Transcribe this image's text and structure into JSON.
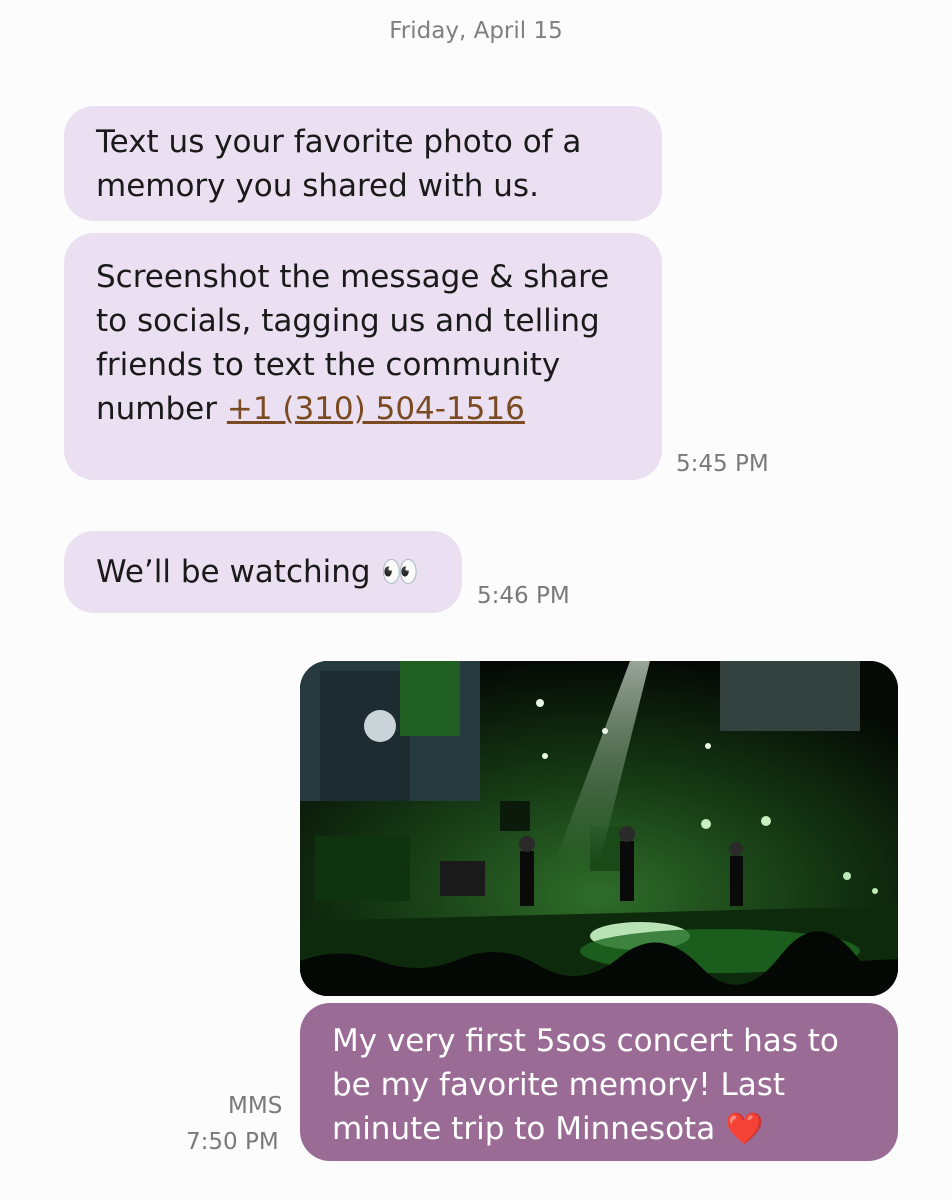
{
  "thread": {
    "date_header": "Friday, April 15"
  },
  "messages": {
    "m1": {
      "text": "Text us your favorite photo of a memory you shared with us."
    },
    "m2": {
      "text": "Screenshot the message & share to socials, tagging us and telling friends to text the community number ",
      "link": "+1 (310) 504-1516",
      "time": "5:45 PM"
    },
    "m3": {
      "text": "We’ll be watching",
      "emoji": "👀",
      "time": "5:46 PM"
    },
    "m4": {
      "text": "My very first 5sos concert has to be my favorite  memory! Last minute trip to Minnesota",
      "emoji": "❤️",
      "type_label": "MMS",
      "time": "7:50 PM"
    }
  },
  "colors": {
    "incoming_bubble": "#ebe0f2",
    "outgoing_bubble": "#9a6b95",
    "link": "#7a4a22"
  }
}
